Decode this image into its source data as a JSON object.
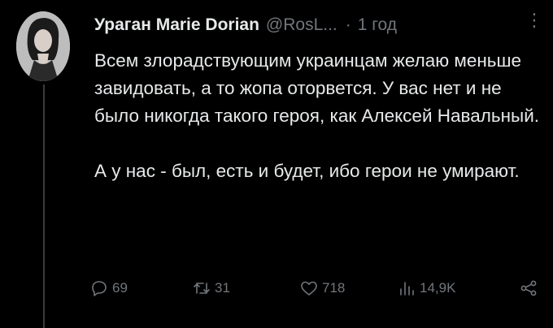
{
  "tweet": {
    "author_name": "Ураган Marie Dorian",
    "author_handle": "@RosL...",
    "separator": "·",
    "time": "1 год",
    "more": "⋮",
    "paragraphs": [
      "Всем злорадствующим украинцам желаю меньше завидовать, а то жопа оторвется. У вас нет и не было никогда такого героя, как Алексей Навальный.",
      "А у нас - был, есть и будет, ибо герои не умирают."
    ],
    "actions": {
      "replies": "69",
      "retweets": "31",
      "likes": "718",
      "views": "14,9K"
    }
  },
  "colors": {
    "background": "#000000",
    "text": "#e7e9ea",
    "secondary": "#71767b"
  }
}
